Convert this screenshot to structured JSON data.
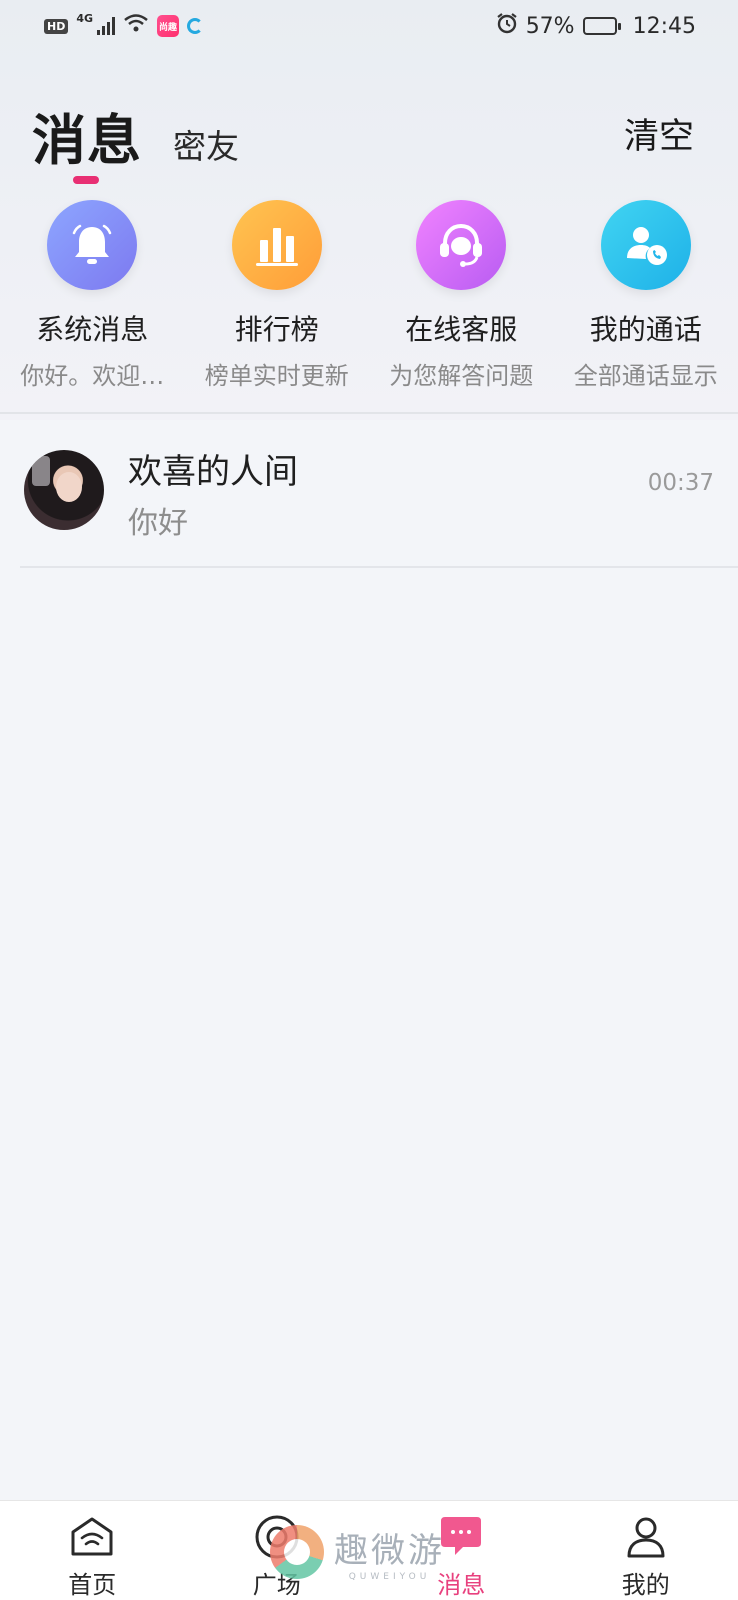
{
  "status_bar": {
    "hd": "HD",
    "network": "4G",
    "app_badge": "尚趣",
    "battery_percent": "57%",
    "battery_level": 0.57,
    "time": "12:45"
  },
  "header": {
    "active_tab": "消息",
    "inactive_tab": "密友",
    "clear_label": "清空",
    "accent_color": "#e82f73"
  },
  "quick_entries": [
    {
      "title": "系统消息",
      "subtitle": "你好。欢迎…",
      "icon": "bell-icon"
    },
    {
      "title": "排行榜",
      "subtitle": "榜单实时更新",
      "icon": "bar-chart-icon"
    },
    {
      "title": "在线客服",
      "subtitle": "为您解答问题",
      "icon": "headset-icon"
    },
    {
      "title": "我的通话",
      "subtitle": "全部通话显示",
      "icon": "contact-phone-icon"
    }
  ],
  "conversations": [
    {
      "name": "欢喜的人间",
      "preview": "你好",
      "time": "00:37"
    }
  ],
  "bottom_nav": [
    {
      "label": "首页",
      "icon": "home-icon",
      "active": false
    },
    {
      "label": "广场",
      "icon": "circle-target-icon",
      "active": false
    },
    {
      "label": "消息",
      "icon": "chat-bubble-icon",
      "active": true
    },
    {
      "label": "我的",
      "icon": "person-icon",
      "active": false
    }
  ],
  "watermark": {
    "main": "趣微游",
    "sub": "QUWEIYOU"
  }
}
